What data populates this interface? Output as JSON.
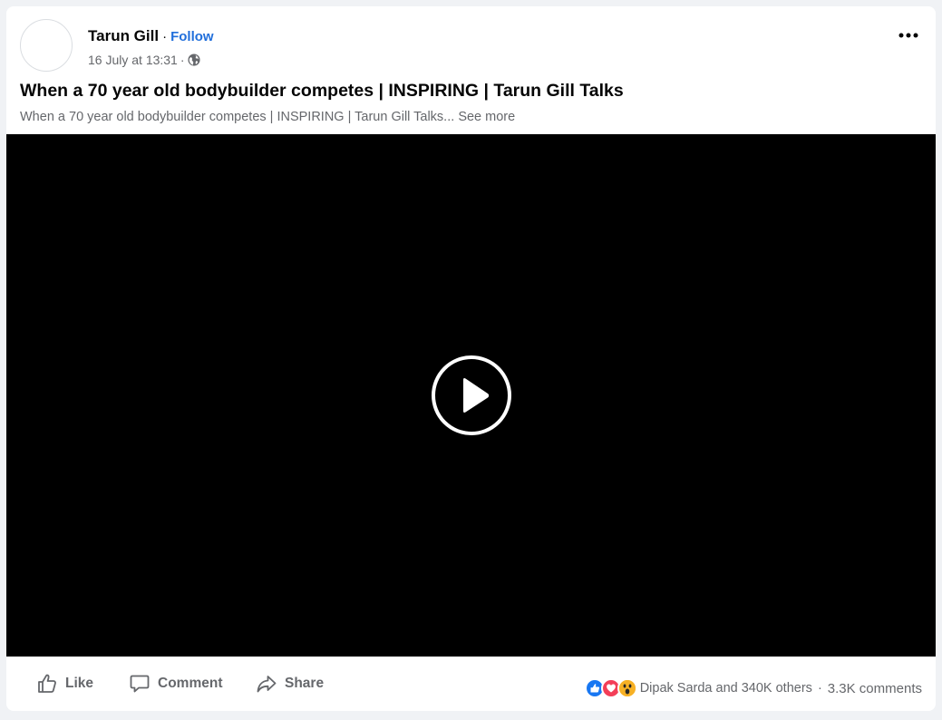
{
  "post": {
    "author": "Tarun Gill",
    "dot": "·",
    "follow_label": "Follow",
    "timestamp": "16 July at 13:31",
    "privacy_icon": "globe-icon",
    "more_icon": "more-options-icon",
    "title": "When a 70 year old bodybuilder competes | INSPIRING | Tarun Gill Talks",
    "description": "When a 70 year old bodybuilder competes | INSPIRING | Tarun Gill Talks...",
    "see_more": "See more"
  },
  "video": {
    "play_icon": "play-icon"
  },
  "actions": {
    "like_label": "Like",
    "comment_label": "Comment",
    "share_label": "Share"
  },
  "reactions": {
    "icons": [
      "like-reaction-icon",
      "love-reaction-icon",
      "wow-reaction-icon"
    ],
    "summary": "Dipak Sarda and 340K others",
    "separator": "·",
    "comments": "3.3K comments"
  },
  "colors": {
    "link_blue": "#216fdb",
    "secondary_text": "#65676b",
    "like_blue": "#1877f2",
    "love_red": "#f33e58",
    "wow_yellow": "#f7b125"
  }
}
